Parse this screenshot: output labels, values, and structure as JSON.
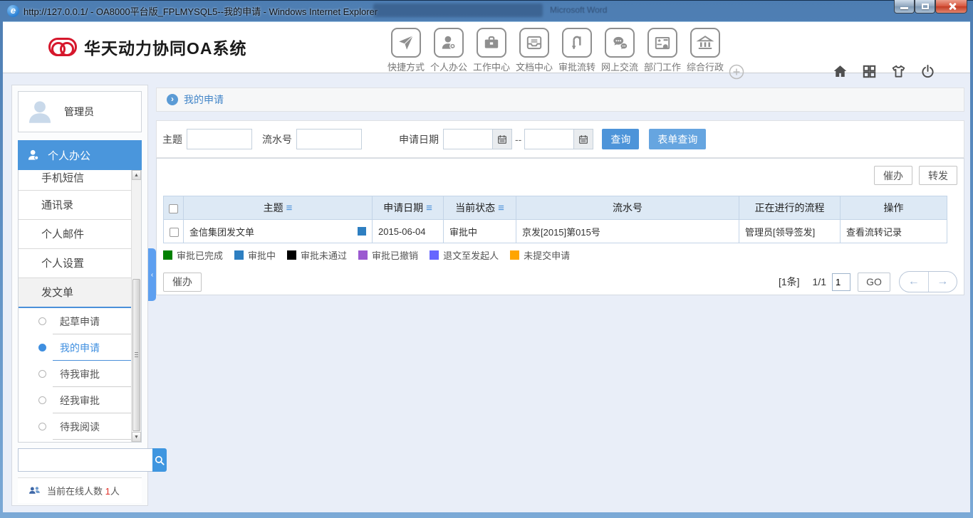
{
  "window": {
    "title": "http://127.0.0.1/ - OA8000平台版_FPLMYSQL5--我的申请 - Windows Internet Explorer",
    "background_title": "Microsoft Word"
  },
  "header": {
    "logo_text": "华天动力协同OA系统",
    "nav": [
      {
        "label": "快捷方式",
        "icon": "paper-plane-icon"
      },
      {
        "label": "个人办公",
        "icon": "person-star-icon"
      },
      {
        "label": "工作中心",
        "icon": "briefcase-icon"
      },
      {
        "label": "文档中心",
        "icon": "document-tray-icon"
      },
      {
        "label": "审批流转",
        "icon": "flow-arrows-icon"
      },
      {
        "label": "网上交流",
        "icon": "chat-bubbles-icon"
      },
      {
        "label": "部门工作",
        "icon": "department-building-icon"
      },
      {
        "label": "综合行政",
        "icon": "bank-icon"
      }
    ]
  },
  "sidebar": {
    "user_name": "管理员",
    "section_label": "个人办公",
    "menu": [
      {
        "label": "手机短信"
      },
      {
        "label": "通讯录"
      },
      {
        "label": "个人邮件"
      },
      {
        "label": "个人设置"
      },
      {
        "label": "发文单",
        "expanded": true
      }
    ],
    "submenu": [
      {
        "label": "起草申请",
        "active": false
      },
      {
        "label": "我的申请",
        "active": true
      },
      {
        "label": "待我审批",
        "active": false
      },
      {
        "label": "经我审批",
        "active": false
      },
      {
        "label": "待我阅读",
        "active": false
      }
    ],
    "online": {
      "label": "当前在线人数",
      "count": "1",
      "unit": "人"
    }
  },
  "main": {
    "breadcrumb_title": "我的申请",
    "filters": {
      "subject_label": "主题",
      "serial_label": "流水号",
      "date_label": "申请日期",
      "separator": "--",
      "query_button": "查询",
      "form_query_button": "表单查询"
    },
    "toolbar": {
      "urge": "催办",
      "forward": "转发"
    },
    "table": {
      "sort_glyph": "≡",
      "headers": [
        "主题",
        "申请日期",
        "当前状态",
        "流水号",
        "正在进行的流程",
        "操作"
      ],
      "rows": [
        {
          "subject": "金信集团发文单",
          "date": "2015-06-04",
          "status": "审批中",
          "serial": "京发[2015]第015号",
          "flow": "管理员[领导签发]",
          "operation": "查看流转记录"
        }
      ]
    },
    "legend": [
      {
        "label": "审批已完成",
        "color": "#008000"
      },
      {
        "label": "审批中",
        "color": "#2e7fc1"
      },
      {
        "label": "审批未通过",
        "color": "#000000"
      },
      {
        "label": "审批已撤销",
        "color": "#9b59d0"
      },
      {
        "label": "退文至发起人",
        "color": "#6666ff"
      },
      {
        "label": "未提交申请",
        "color": "#ffa500"
      }
    ],
    "footer": {
      "urge": "催办",
      "total": "[1条]",
      "page": "1/1",
      "page_value": "1",
      "go": "GO",
      "prev_icon": "←",
      "next_icon": "→"
    }
  },
  "icons": {
    "breadcrumb_arrow": "›",
    "collapse": "‹",
    "scroll_up": "▲",
    "scroll_down": "▼"
  }
}
